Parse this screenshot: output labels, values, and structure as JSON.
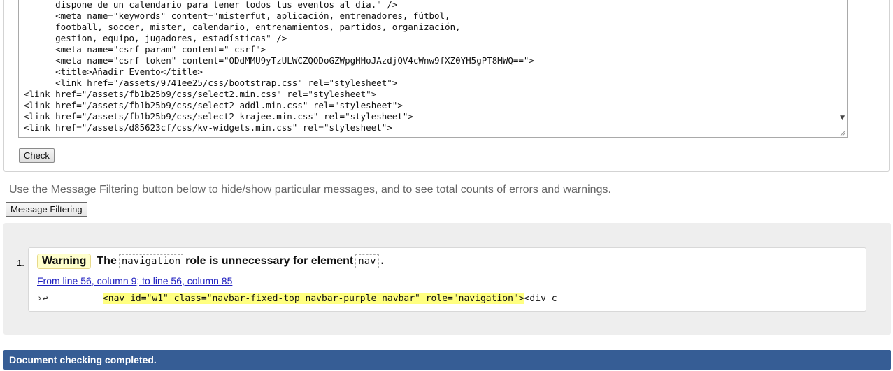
{
  "source": {
    "lines": [
      "      dispone de un calendario para tener todos tus eventos al día.\" />",
      "      <meta name=\"keywords\" content=\"misterfut, aplicación, entrenadores, fútbol,",
      "      football, soccer, mister, calendario, entrenamientos, partidos, organización,",
      "      gestion, equipo, jugadores, estadísticas\" />",
      "      <meta name=\"csrf-param\" content=\"_csrf\">",
      "      <meta name=\"csrf-token\" content=\"ODdMMU9yTzULWCZQODoGZWpgHHoJAzdjQV4cWnw9fXZ0YH5gPT8MWQ==\">",
      "      <title>Añadir Evento</title>",
      "      <link href=\"/assets/9741ee25/css/bootstrap.css\" rel=\"stylesheet\">",
      "<link href=\"/assets/fb1b25b9/css/select2.min.css\" rel=\"stylesheet\">",
      "<link href=\"/assets/fb1b25b9/css/select2-addl.min.css\" rel=\"stylesheet\">",
      "<link href=\"/assets/fb1b25b9/css/select2-krajee.min.css\" rel=\"stylesheet\">",
      "<link href=\"/assets/d85623cf/css/kv-widgets.min.css\" rel=\"stylesheet\">"
    ],
    "check_label": "Check"
  },
  "info": {
    "text": "Use the Message Filtering button below to hide/show particular messages, and to see total counts of errors and warnings.",
    "filter_label": "Message Filtering"
  },
  "results": {
    "messages": [
      {
        "number": "1.",
        "type": "Warning",
        "text_before": "The",
        "code1": "navigation",
        "text_middle": "role is unnecessary for element",
        "code2": "nav",
        "text_after": ".",
        "location": "From line 56, column 9; to line 56, column 85",
        "extract_marker": "›↩",
        "extract_highlight": "<nav id=\"w1\" class=\"navbar-fixed-top navbar-purple navbar\" role=\"navigation\">",
        "extract_after": "<div c"
      }
    ]
  },
  "status": {
    "text": "Document checking completed."
  },
  "colors": {
    "status_bar": "#365d95",
    "warning_badge": "#ffffcc",
    "highlight": "#ffff80"
  }
}
